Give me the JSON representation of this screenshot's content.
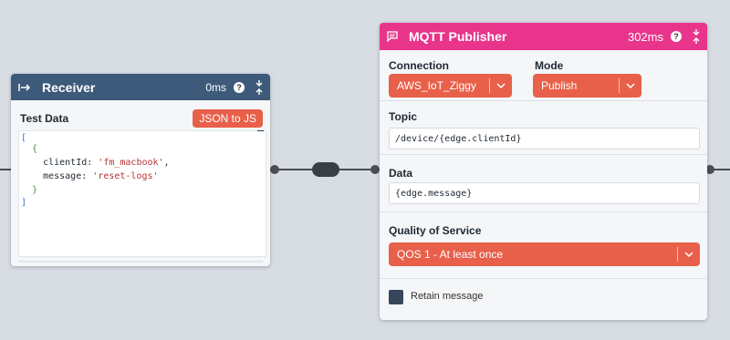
{
  "receiver": {
    "title": "Receiver",
    "timing": "0ms",
    "help": "?",
    "test_data_label": "Test Data",
    "json_button": "JSON to JS",
    "code": {
      "l1": "[",
      "l2": "  {",
      "l3_key": "    clientId: ",
      "l3_val": "'fm_macbook'",
      "l3_end": ",",
      "l4_key": "    message: ",
      "l4_val": "'reset-logs'",
      "l5": "  }",
      "l6": "]"
    }
  },
  "mqtt": {
    "title": "MQTT Publisher",
    "timing": "302ms",
    "help": "?",
    "connection_label": "Connection",
    "connection_value": "AWS_IoT_Ziggy",
    "mode_label": "Mode",
    "mode_value": "Publish",
    "topic_label": "Topic",
    "topic_value": "/device/{edge.clientId}",
    "data_label": "Data",
    "data_value": "{edge.message}",
    "qos_label": "Quality of Service",
    "qos_value": "QOS 1 - At least once",
    "retain_label": "Retain message"
  },
  "colors": {
    "canvas": "#d7dde3",
    "receiver_header": "#3d5a7a",
    "mqtt_header": "#e8358b",
    "accent": "#e8604a"
  }
}
